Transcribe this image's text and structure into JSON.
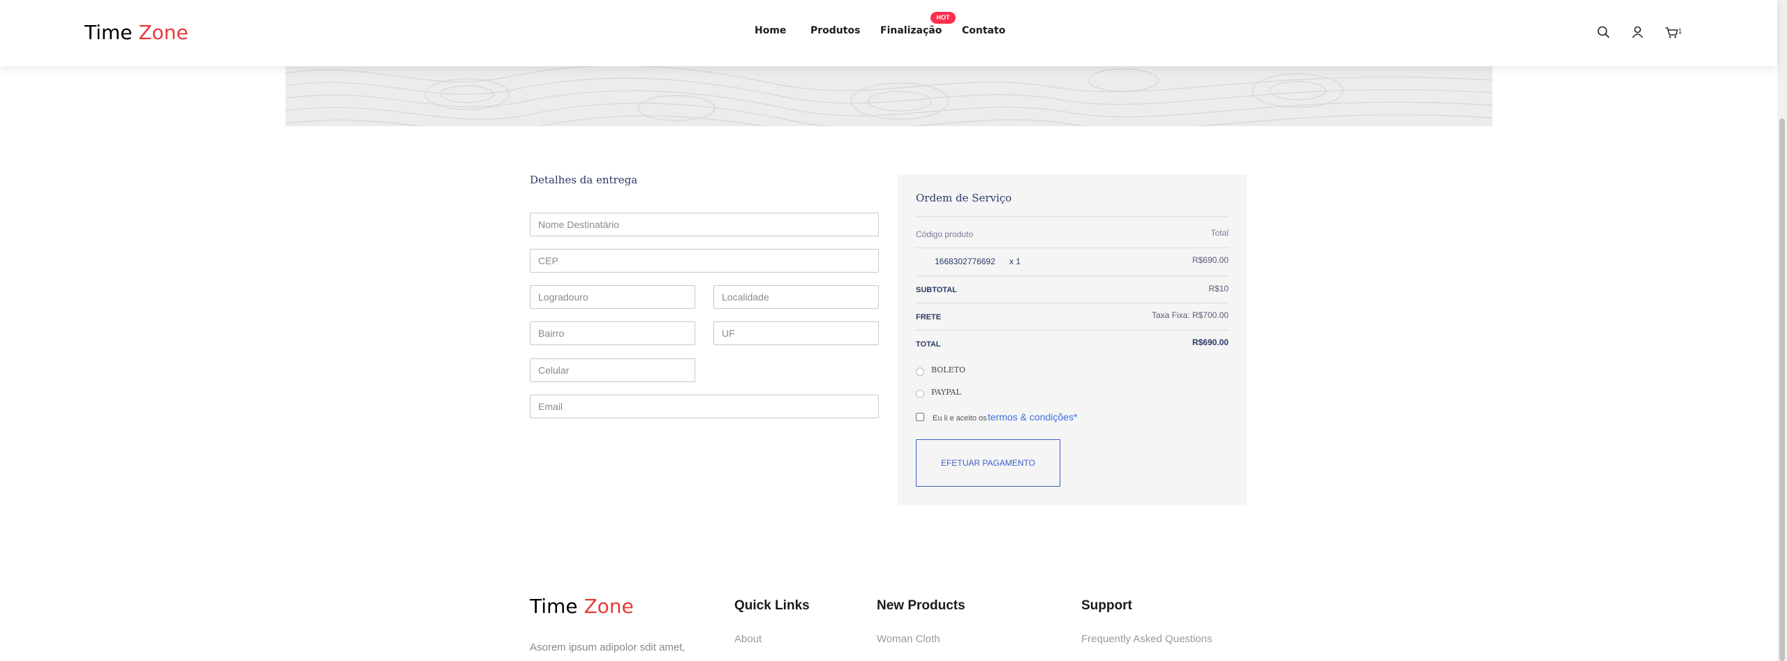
{
  "brand": {
    "first": "Time",
    "second": "Zone"
  },
  "nav": {
    "items": [
      "Home",
      "Produtos",
      "Finalização",
      "Contato"
    ],
    "hot_badge": "HOT"
  },
  "header_icons": {
    "search": "search-icon",
    "user": "user-icon",
    "cart": "cart-icon",
    "cart_count": "1"
  },
  "delivery": {
    "title": "Detalhes da entrega",
    "placeholders": {
      "name": "Nome Destinatário",
      "cep": "CEP",
      "street": "Logradouro",
      "city": "Localidade",
      "district": "Bairro",
      "state": "UF",
      "phone": "Celular",
      "email": "Email"
    }
  },
  "order": {
    "title": "Ordem de Serviço",
    "header_left": "Código produto",
    "header_right": "Total",
    "product_code": "1668302776692",
    "product_qty": "x 1",
    "product_total": "R$690.00",
    "subtotal_label": "SUBTOTAL",
    "subtotal_value": "R$10",
    "frete_label": "FRETE",
    "frete_value": "Taxa Fixa: R$700.00",
    "total_label": "TOTAL",
    "total_value": "R$690.00",
    "payment_options": [
      "BOLETO",
      "PAYPAL"
    ],
    "terms_prefix": "Eu li e aceito os",
    "terms_link": "termos & condições*",
    "pay_button": "Efetuar Pagamento"
  },
  "footer": {
    "description": "Asorem ipsum adipolor sdit amet,",
    "quick_links_title": "Quick Links",
    "quick_links": [
      "About"
    ],
    "new_products_title": "New Products",
    "new_products": [
      "Woman Cloth"
    ],
    "support_title": "Support",
    "support": [
      "Frequently Asked Questions"
    ]
  },
  "colors": {
    "brand_accent": "#e53a3a",
    "hot_badge": "#ff2e4d",
    "link_blue": "#3d6ee0",
    "button_blue": "#3b5fc6",
    "heading_navy": "#2b3a66"
  }
}
